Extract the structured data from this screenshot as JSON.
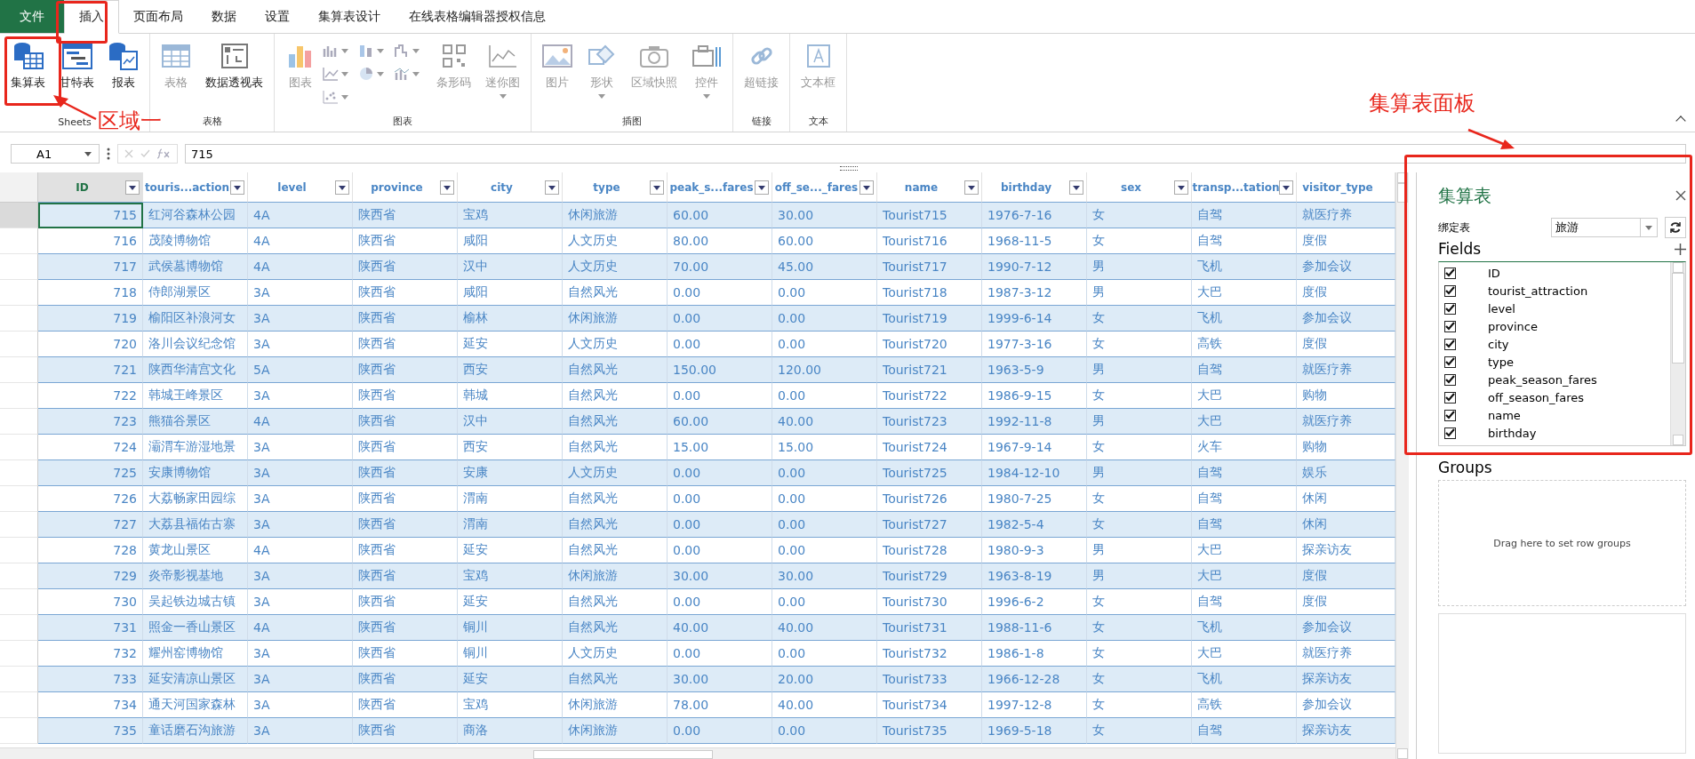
{
  "ribbon": {
    "tabs": [
      {
        "label": "文件",
        "kind": "file",
        "selected": false
      },
      {
        "label": "插入",
        "kind": "tab",
        "selected": true
      },
      {
        "label": "页面布局",
        "kind": "tab",
        "selected": false
      },
      {
        "label": "数据",
        "kind": "tab",
        "selected": false
      },
      {
        "label": "设置",
        "kind": "tab",
        "selected": false
      },
      {
        "label": "集算表设计",
        "kind": "tab",
        "selected": false
      },
      {
        "label": "在线表格编辑器授权信息",
        "kind": "tab",
        "selected": false
      }
    ],
    "groups": [
      {
        "label": "Sheets",
        "buttons": [
          {
            "label": "集算表",
            "disabled": false,
            "dropdown": false
          },
          {
            "label": "甘特表",
            "disabled": false,
            "dropdown": false
          },
          {
            "label": "报表",
            "disabled": false,
            "dropdown": false
          }
        ]
      },
      {
        "label": "表格",
        "buttons": [
          {
            "label": "表格",
            "disabled": true,
            "dropdown": false
          },
          {
            "label": "数据透视表",
            "disabled": false,
            "dropdown": false
          }
        ]
      },
      {
        "label": "图表",
        "buttons": [
          {
            "label": "图表",
            "disabled": true,
            "dropdown": false
          },
          {
            "label": "条形码",
            "disabled": true,
            "dropdown": false
          },
          {
            "label": "迷你图",
            "disabled": true,
            "dropdown": true
          }
        ]
      },
      {
        "label": "插图",
        "buttons": [
          {
            "label": "图片",
            "disabled": true,
            "dropdown": false
          },
          {
            "label": "形状",
            "disabled": true,
            "dropdown": true
          },
          {
            "label": "区域快照",
            "disabled": true,
            "dropdown": false
          },
          {
            "label": "控件",
            "disabled": true,
            "dropdown": true
          }
        ]
      },
      {
        "label": "链接",
        "buttons": [
          {
            "label": "超链接",
            "disabled": true,
            "dropdown": false
          }
        ]
      },
      {
        "label": "文本",
        "buttons": [
          {
            "label": "文本框",
            "disabled": true,
            "dropdown": false
          }
        ]
      }
    ]
  },
  "formula_bar": {
    "name_box": "A1",
    "formula": "715"
  },
  "table": {
    "columns": [
      {
        "label": "ID",
        "selected": true
      },
      {
        "label": "touris...action",
        "selected": false
      },
      {
        "label": "level",
        "selected": false
      },
      {
        "label": "province",
        "selected": false
      },
      {
        "label": "city",
        "selected": false
      },
      {
        "label": "type",
        "selected": false
      },
      {
        "label": "peak_s...fares",
        "selected": false
      },
      {
        "label": "off_se..._fares",
        "selected": false
      },
      {
        "label": "name",
        "selected": false
      },
      {
        "label": "birthday",
        "selected": false
      },
      {
        "label": "sex",
        "selected": false
      },
      {
        "label": "transp...tation",
        "selected": false
      },
      {
        "label": "visitor_type",
        "selected": false
      }
    ],
    "rows": [
      {
        "selected": true,
        "cells": [
          "715",
          "红河谷森林公园",
          "4A",
          "陕西省",
          "宝鸡",
          "休闲旅游",
          "60.00",
          "30.00",
          "Tourist715",
          "1976-7-16",
          "女",
          "自驾",
          "就医疗养"
        ]
      },
      {
        "selected": false,
        "cells": [
          "716",
          "茂陵博物馆",
          "4A",
          "陕西省",
          "咸阳",
          "人文历史",
          "80.00",
          "60.00",
          "Tourist716",
          "1968-11-5",
          "女",
          "自驾",
          "度假"
        ]
      },
      {
        "selected": false,
        "cells": [
          "717",
          "武侯墓博物馆",
          "4A",
          "陕西省",
          "汉中",
          "人文历史",
          "70.00",
          "45.00",
          "Tourist717",
          "1990-7-12",
          "男",
          "飞机",
          "参加会议"
        ]
      },
      {
        "selected": false,
        "cells": [
          "718",
          "侍郎湖景区",
          "3A",
          "陕西省",
          "咸阳",
          "自然风光",
          "0.00",
          "0.00",
          "Tourist718",
          "1987-3-12",
          "男",
          "大巴",
          "度假"
        ]
      },
      {
        "selected": false,
        "cells": [
          "719",
          "榆阳区补浪河女",
          "3A",
          "陕西省",
          "榆林",
          "休闲旅游",
          "0.00",
          "0.00",
          "Tourist719",
          "1999-6-14",
          "女",
          "飞机",
          "参加会议"
        ]
      },
      {
        "selected": false,
        "cells": [
          "720",
          "洛川会议纪念馆",
          "3A",
          "陕西省",
          "延安",
          "人文历史",
          "0.00",
          "0.00",
          "Tourist720",
          "1977-3-16",
          "女",
          "高铁",
          "度假"
        ]
      },
      {
        "selected": false,
        "cells": [
          "721",
          "陕西华清宫文化",
          "5A",
          "陕西省",
          "西安",
          "自然风光",
          "150.00",
          "120.00",
          "Tourist721",
          "1963-5-9",
          "男",
          "自驾",
          "就医疗养"
        ]
      },
      {
        "selected": false,
        "cells": [
          "722",
          "韩城王峰景区",
          "3A",
          "陕西省",
          "韩城",
          "自然风光",
          "0.00",
          "0.00",
          "Tourist722",
          "1986-9-15",
          "女",
          "大巴",
          "购物"
        ]
      },
      {
        "selected": false,
        "cells": [
          "723",
          "熊猫谷景区",
          "4A",
          "陕西省",
          "汉中",
          "自然风光",
          "60.00",
          "40.00",
          "Tourist723",
          "1992-11-8",
          "男",
          "大巴",
          "就医疗养"
        ]
      },
      {
        "selected": false,
        "cells": [
          "724",
          "灞渭车游湿地景",
          "3A",
          "陕西省",
          "西安",
          "自然风光",
          "15.00",
          "15.00",
          "Tourist724",
          "1967-9-14",
          "女",
          "火车",
          "购物"
        ]
      },
      {
        "selected": false,
        "cells": [
          "725",
          "安康博物馆",
          "3A",
          "陕西省",
          "安康",
          "人文历史",
          "0.00",
          "0.00",
          "Tourist725",
          "1984-12-10",
          "男",
          "自驾",
          "娱乐"
        ]
      },
      {
        "selected": false,
        "cells": [
          "726",
          "大荔畅家田园综",
          "3A",
          "陕西省",
          "渭南",
          "自然风光",
          "0.00",
          "0.00",
          "Tourist726",
          "1980-7-25",
          "女",
          "自驾",
          "休闲"
        ]
      },
      {
        "selected": false,
        "cells": [
          "727",
          "大荔县福佑古寨",
          "3A",
          "陕西省",
          "渭南",
          "自然风光",
          "0.00",
          "0.00",
          "Tourist727",
          "1982-5-4",
          "女",
          "自驾",
          "休闲"
        ]
      },
      {
        "selected": false,
        "cells": [
          "728",
          "黄龙山景区",
          "4A",
          "陕西省",
          "延安",
          "自然风光",
          "0.00",
          "0.00",
          "Tourist728",
          "1980-9-3",
          "男",
          "大巴",
          "探亲访友"
        ]
      },
      {
        "selected": false,
        "cells": [
          "729",
          "炎帝影视基地",
          "3A",
          "陕西省",
          "宝鸡",
          "休闲旅游",
          "30.00",
          "30.00",
          "Tourist729",
          "1963-8-19",
          "男",
          "大巴",
          "度假"
        ]
      },
      {
        "selected": false,
        "cells": [
          "730",
          "吴起铁边城古镇",
          "3A",
          "陕西省",
          "延安",
          "自然风光",
          "0.00",
          "0.00",
          "Tourist730",
          "1996-6-2",
          "女",
          "自驾",
          "度假"
        ]
      },
      {
        "selected": false,
        "cells": [
          "731",
          "照金一香山景区",
          "4A",
          "陕西省",
          "铜川",
          "自然风光",
          "40.00",
          "40.00",
          "Tourist731",
          "1988-11-6",
          "女",
          "飞机",
          "参加会议"
        ]
      },
      {
        "selected": false,
        "cells": [
          "732",
          "耀州窑博物馆",
          "3A",
          "陕西省",
          "铜川",
          "人文历史",
          "0.00",
          "0.00",
          "Tourist732",
          "1986-1-8",
          "女",
          "大巴",
          "就医疗养"
        ]
      },
      {
        "selected": false,
        "cells": [
          "733",
          "延安清凉山景区",
          "3A",
          "陕西省",
          "延安",
          "自然风光",
          "30.00",
          "20.00",
          "Tourist733",
          "1966-12-28",
          "女",
          "飞机",
          "探亲访友"
        ]
      },
      {
        "selected": false,
        "cells": [
          "734",
          "通天河国家森林",
          "3A",
          "陕西省",
          "宝鸡",
          "休闲旅游",
          "78.00",
          "40.00",
          "Tourist734",
          "1997-12-8",
          "女",
          "高铁",
          "参加会议"
        ]
      },
      {
        "selected": false,
        "cells": [
          "735",
          "童话磨石沟旅游",
          "3A",
          "陕西省",
          "商洛",
          "休闲旅游",
          "0.00",
          "0.00",
          "Tourist735",
          "1969-5-18",
          "女",
          "自驾",
          "探亲访友"
        ]
      }
    ]
  },
  "panel": {
    "title": "集算表",
    "bind_label": "绑定表",
    "bind_value": "旅游",
    "fields_title": "Fields",
    "fields": [
      {
        "label": "ID",
        "checked": true
      },
      {
        "label": "tourist_attraction",
        "checked": true
      },
      {
        "label": "level",
        "checked": true
      },
      {
        "label": "province",
        "checked": true
      },
      {
        "label": "city",
        "checked": true
      },
      {
        "label": "type",
        "checked": true
      },
      {
        "label": "peak_season_fares",
        "checked": true
      },
      {
        "label": "off_season_fares",
        "checked": true
      },
      {
        "label": "name",
        "checked": true
      },
      {
        "label": "birthday",
        "checked": true
      }
    ],
    "groups_title": "Groups",
    "groups_hint": "Drag here to set row groups"
  },
  "annotations": [
    {
      "text": "区域一"
    },
    {
      "text": "集算表面板"
    }
  ]
}
